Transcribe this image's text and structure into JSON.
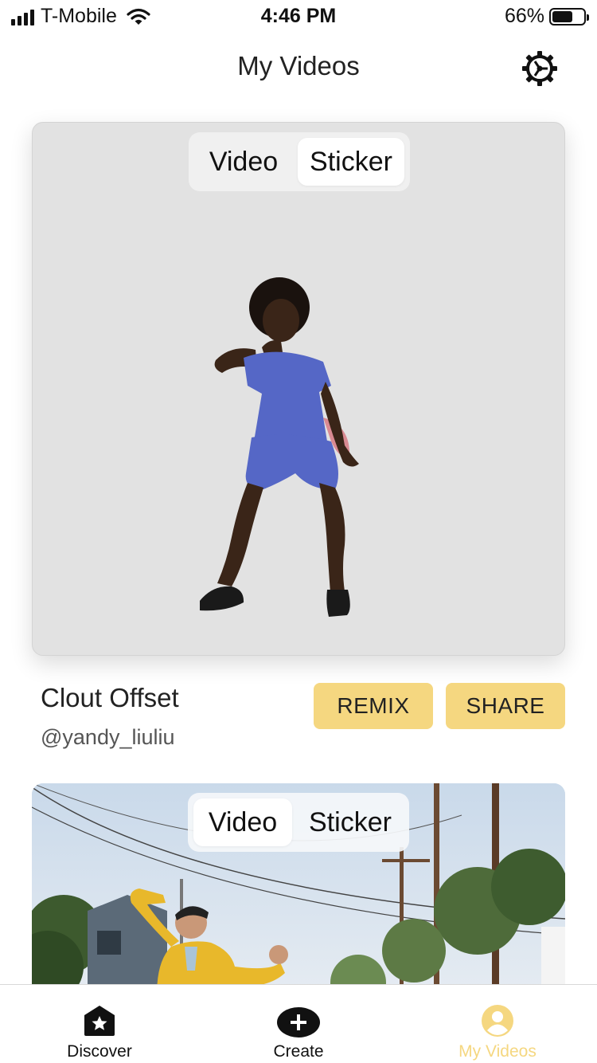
{
  "status_bar": {
    "carrier": "T-Mobile",
    "time": "4:46 PM",
    "battery_percent": "66%",
    "battery_level": 0.66,
    "signal_icon": "signal-bars-icon",
    "wifi_icon": "wifi-icon",
    "battery_icon": "battery-icon"
  },
  "header": {
    "title": "My Videos",
    "settings_icon": "gear-icon"
  },
  "videos": [
    {
      "segment": {
        "video_label": "Video",
        "sticker_label": "Sticker",
        "selected": "Sticker"
      },
      "title": "Clout Offset",
      "author": "@yandy_liuliu",
      "remix_label": "REMIX",
      "share_label": "SHARE"
    },
    {
      "segment": {
        "video_label": "Video",
        "sticker_label": "Sticker",
        "selected": "Video"
      }
    }
  ],
  "tab_bar": {
    "items": [
      {
        "label": "Discover",
        "icon": "house-star-icon"
      },
      {
        "label": "Create",
        "icon": "plus-circle-icon"
      },
      {
        "label": "My Videos",
        "icon": "person-circle-icon",
        "active": true
      }
    ]
  },
  "colors": {
    "accent": "#f5d780",
    "card_background": "#e2e2e2",
    "text_primary": "#222222",
    "text_secondary": "#555555"
  }
}
